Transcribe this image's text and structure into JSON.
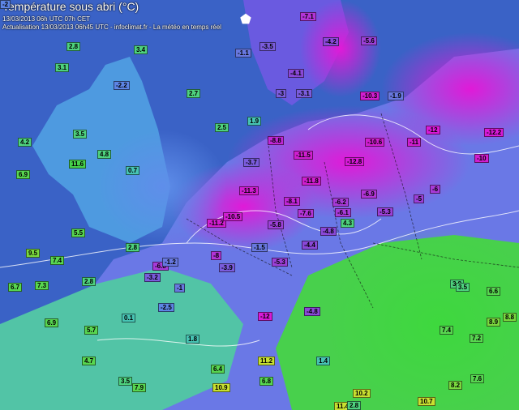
{
  "header": {
    "title": "Température sous abri (°C)",
    "line1": "13/03/2013  06h UTC  07h CET",
    "line2": "Actualisation 13/03/2013 06h45 UTC - infoclimat.fr - La météo en temps réel"
  },
  "icons": {
    "country_marker": "france-outline-icon"
  },
  "colors": {
    "sea": "#3b64c8",
    "very_cold": "#d81ad8",
    "cold": "#8a4cd8",
    "cool": "#5a8ae8",
    "mild": "#58c6a0",
    "warm": "#46d24a"
  },
  "stations": [
    {
      "v": "-3.7",
      "c": "#7a5cdc"
    },
    {
      "v": "-2.2",
      "c": "#5d85e5"
    },
    {
      "v": "0.7",
      "c": "#47c4b4"
    },
    {
      "v": "-1.1",
      "c": "#6878e0"
    },
    {
      "v": "-4.1",
      "c": "#8a48d8"
    },
    {
      "v": "-3.1",
      "c": "#7a5cdc"
    },
    {
      "v": "-5.6",
      "c": "#9c40d8"
    },
    {
      "v": "-4.2",
      "c": "#8a48d8"
    },
    {
      "v": "-7.1",
      "c": "#b234d6"
    },
    {
      "v": "-3.5",
      "c": "#7a5cdc"
    },
    {
      "v": "2.8",
      "c": "#4ed27e"
    },
    {
      "v": "3.1",
      "c": "#4ed27e"
    },
    {
      "v": "-1.5",
      "c": "#6878e0"
    },
    {
      "v": "-1.9",
      "c": "#6878e0"
    },
    {
      "v": "-10.3",
      "c": "#d01ed0"
    },
    {
      "v": "2.7",
      "c": "#4ed27e"
    },
    {
      "v": "3.4",
      "c": "#4ed27e"
    },
    {
      "v": "1.9",
      "c": "#47c4b4"
    },
    {
      "v": "2.5",
      "c": "#4ed27e"
    },
    {
      "v": "-10.6",
      "c": "#d01ed0"
    },
    {
      "v": "-11",
      "c": "#d01ed0"
    },
    {
      "v": "-12",
      "c": "#d81ad8"
    },
    {
      "v": "-12.2",
      "c": "#d81ad8"
    },
    {
      "v": "-11.5",
      "c": "#d01ed0"
    },
    {
      "v": "-8.8",
      "c": "#c026d6"
    },
    {
      "v": "-12.8",
      "c": "#d81ad8"
    },
    {
      "v": "4.8",
      "c": "#4ed27e"
    },
    {
      "v": "3.5",
      "c": "#4ed27e"
    },
    {
      "v": "4.2",
      "c": "#4ed27e"
    },
    {
      "v": "6.9",
      "c": "#58d650"
    },
    {
      "v": "11.6",
      "c": "#46d24a"
    },
    {
      "v": "-11.8",
      "c": "#d01ed0"
    },
    {
      "v": "-6.2",
      "c": "#a83ad8"
    },
    {
      "v": "-4.8",
      "c": "#8a48d8"
    },
    {
      "v": "-6.9",
      "c": "#b234d6"
    },
    {
      "v": "-6",
      "c": "#a83ad8"
    },
    {
      "v": "-5",
      "c": "#9c40d8"
    },
    {
      "v": "-3",
      "c": "#7a5cdc"
    },
    {
      "v": "-10",
      "c": "#d01ed0"
    },
    {
      "v": "-7.6",
      "c": "#b234d6"
    },
    {
      "v": "-5.3",
      "c": "#9c40d8"
    },
    {
      "v": "-6.1",
      "c": "#a83ad8"
    },
    {
      "v": "-11.2",
      "c": "#d01ed0"
    },
    {
      "v": "-10.5",
      "c": "#d01ed0"
    },
    {
      "v": "-11.3",
      "c": "#d01ed0"
    },
    {
      "v": "-8.1",
      "c": "#c026d6"
    },
    {
      "v": "-5.8",
      "c": "#9c40d8"
    },
    {
      "v": "-4.4",
      "c": "#8a48d8"
    },
    {
      "v": "-6.8",
      "c": "#a83ad8"
    },
    {
      "v": "-3.9",
      "c": "#7a5cdc"
    },
    {
      "v": "-5.3",
      "c": "#9c40d8"
    },
    {
      "v": "5.5",
      "c": "#58d650"
    },
    {
      "v": "9.5",
      "c": "#7ad83e"
    },
    {
      "v": "7.4",
      "c": "#58d650"
    },
    {
      "v": "6.7",
      "c": "#58d650"
    },
    {
      "v": "7.3",
      "c": "#58d650"
    },
    {
      "v": "2.8",
      "c": "#4ed27e"
    },
    {
      "v": "-3.2",
      "c": "#7a5cdc"
    },
    {
      "v": "-1.2",
      "c": "#6878e0"
    },
    {
      "v": "-2.5",
      "c": "#5d85e5"
    },
    {
      "v": "0.1",
      "c": "#47c4b4"
    },
    {
      "v": "5.7",
      "c": "#58d650"
    },
    {
      "v": "6.9",
      "c": "#58d650"
    },
    {
      "v": "-12",
      "c": "#d81ad8"
    },
    {
      "v": "-4.8",
      "c": "#8a48d8"
    },
    {
      "v": "2.8",
      "c": "#4ed27e"
    },
    {
      "v": "3.8",
      "c": "#4ed27e"
    },
    {
      "v": "11.2",
      "c": "#c8e030"
    },
    {
      "v": "10.9",
      "c": "#c8e030"
    },
    {
      "v": "7.9",
      "c": "#58d650"
    },
    {
      "v": "4.7",
      "c": "#58d650"
    },
    {
      "v": "3.5",
      "c": "#4ed27e"
    },
    {
      "v": "1.4",
      "c": "#47c4b4"
    },
    {
      "v": "6.8",
      "c": "#58d650"
    },
    {
      "v": "10.2",
      "c": "#c8e030"
    },
    {
      "v": "11.4",
      "c": "#c8e030"
    },
    {
      "v": "2.8",
      "c": "#4ed27e"
    },
    {
      "v": "10.7",
      "c": "#c8e030"
    },
    {
      "v": "8.2",
      "c": "#7ad83e"
    },
    {
      "v": "7.6",
      "c": "#58d650"
    },
    {
      "v": "8.9",
      "c": "#7ad83e"
    },
    {
      "v": "3.5",
      "c": "#4ed27e"
    },
    {
      "v": "6.6",
      "c": "#58d650"
    },
    {
      "v": "7.2",
      "c": "#58d650"
    },
    {
      "v": "8.8",
      "c": "#7ad83e"
    },
    {
      "v": "7.4",
      "c": "#58d650"
    },
    {
      "v": "6.4",
      "c": "#58d650"
    },
    {
      "v": "1.8",
      "c": "#47c4b4"
    },
    {
      "v": "4.3",
      "c": "#4ed27e"
    },
    {
      "v": "-8",
      "c": "#b234d6"
    },
    {
      "v": "-1",
      "c": "#6878e0"
    },
    {
      "v": "-2",
      "c": "#5d85e5"
    }
  ]
}
